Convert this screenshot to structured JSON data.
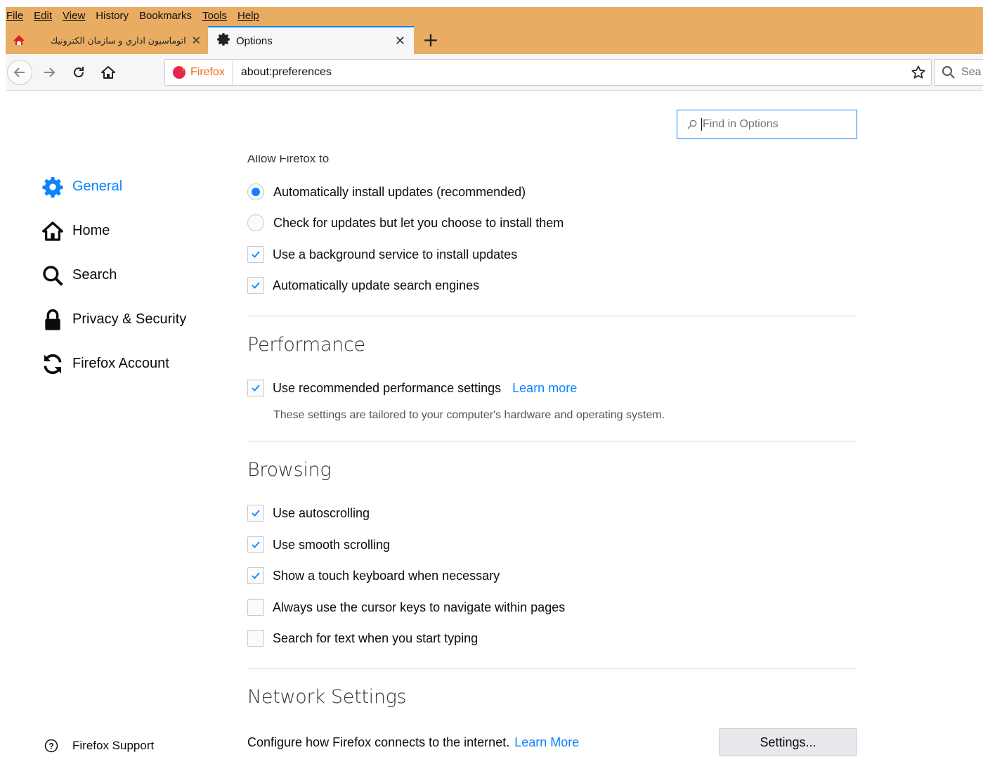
{
  "menubar": {
    "items": [
      "File",
      "Edit",
      "View",
      "History",
      "Bookmarks",
      "Tools",
      "Help"
    ]
  },
  "tabs": [
    {
      "title": "اتوماسیون اداري و سازمان الكترونیك",
      "active": false
    },
    {
      "title": "Options",
      "active": true
    }
  ],
  "newtab_label": "+",
  "urlbar": {
    "identity_label": "Firefox",
    "url": "about:preferences"
  },
  "searchbar": {
    "placeholder": "Sea"
  },
  "find": {
    "placeholder": "Find in Options"
  },
  "sidebar": {
    "categories": [
      {
        "label": "General",
        "icon": "gear-icon",
        "selected": true
      },
      {
        "label": "Home",
        "icon": "home-icon",
        "selected": false
      },
      {
        "label": "Search",
        "icon": "magnifier-icon",
        "selected": false
      },
      {
        "label": "Privacy & Security",
        "icon": "lock-icon",
        "selected": false
      },
      {
        "label": "Firefox Account",
        "icon": "sync-icon",
        "selected": false
      }
    ],
    "support_label": "Firefox Support"
  },
  "updates": {
    "heading_cut": "Allow Firefox to",
    "auto_install": {
      "label": "Automatically install updates (recommended)",
      "selected": true
    },
    "check_only": {
      "label": "Check for updates but let you choose to install them",
      "selected": false
    },
    "background_service": {
      "label": "Use a background service to install updates",
      "checked": true
    },
    "update_search_engines": {
      "label": "Automatically update search engines",
      "checked": true
    }
  },
  "performance": {
    "title": "Performance",
    "use_recommended": {
      "label": "Use recommended performance settings",
      "checked": true
    },
    "learn_more": "Learn more",
    "description": "These settings are tailored to your computer's hardware and operating system."
  },
  "browsing": {
    "title": "Browsing",
    "autoscrolling": {
      "label": "Use autoscrolling",
      "checked": true
    },
    "smooth_scrolling": {
      "label": "Use smooth scrolling",
      "checked": true
    },
    "touch_keyboard": {
      "label": "Show a touch keyboard when necessary",
      "checked": true
    },
    "cursor_keys": {
      "label": "Always use the cursor keys to navigate within pages",
      "checked": false
    },
    "search_typing": {
      "label": "Search for text when you start typing",
      "checked": false
    }
  },
  "network": {
    "title": "Network Settings",
    "description": "Configure how Firefox connects to the internet.",
    "learn_more": "Learn More",
    "settings_button": "Settings..."
  },
  "colors": {
    "chrome_bg": "#e8ac62",
    "accent": "#0a84ff",
    "toolbar_bg": "#f5f6f7"
  }
}
